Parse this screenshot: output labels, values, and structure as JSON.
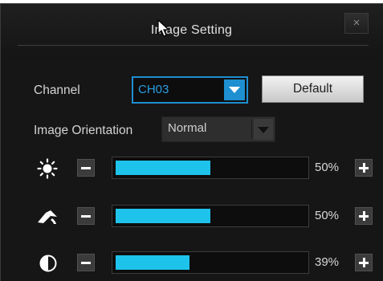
{
  "dialog": {
    "title": "Image Setting",
    "close_label": "×",
    "accent_color": "#1e8fd0",
    "bar_color": "#1ec3eb"
  },
  "channel": {
    "label": "Channel",
    "value": "CH03",
    "default_button": "Default"
  },
  "orientation": {
    "label": "Image Orientation",
    "value": "Normal"
  },
  "sliders": [
    {
      "name": "brightness",
      "icon": "sun-icon",
      "value": 50,
      "display": "50%"
    },
    {
      "name": "color",
      "icon": "paint-bucket-icon",
      "value": 50,
      "display": "50%"
    },
    {
      "name": "contrast",
      "icon": "contrast-icon",
      "value": 39,
      "display": "39%"
    }
  ]
}
